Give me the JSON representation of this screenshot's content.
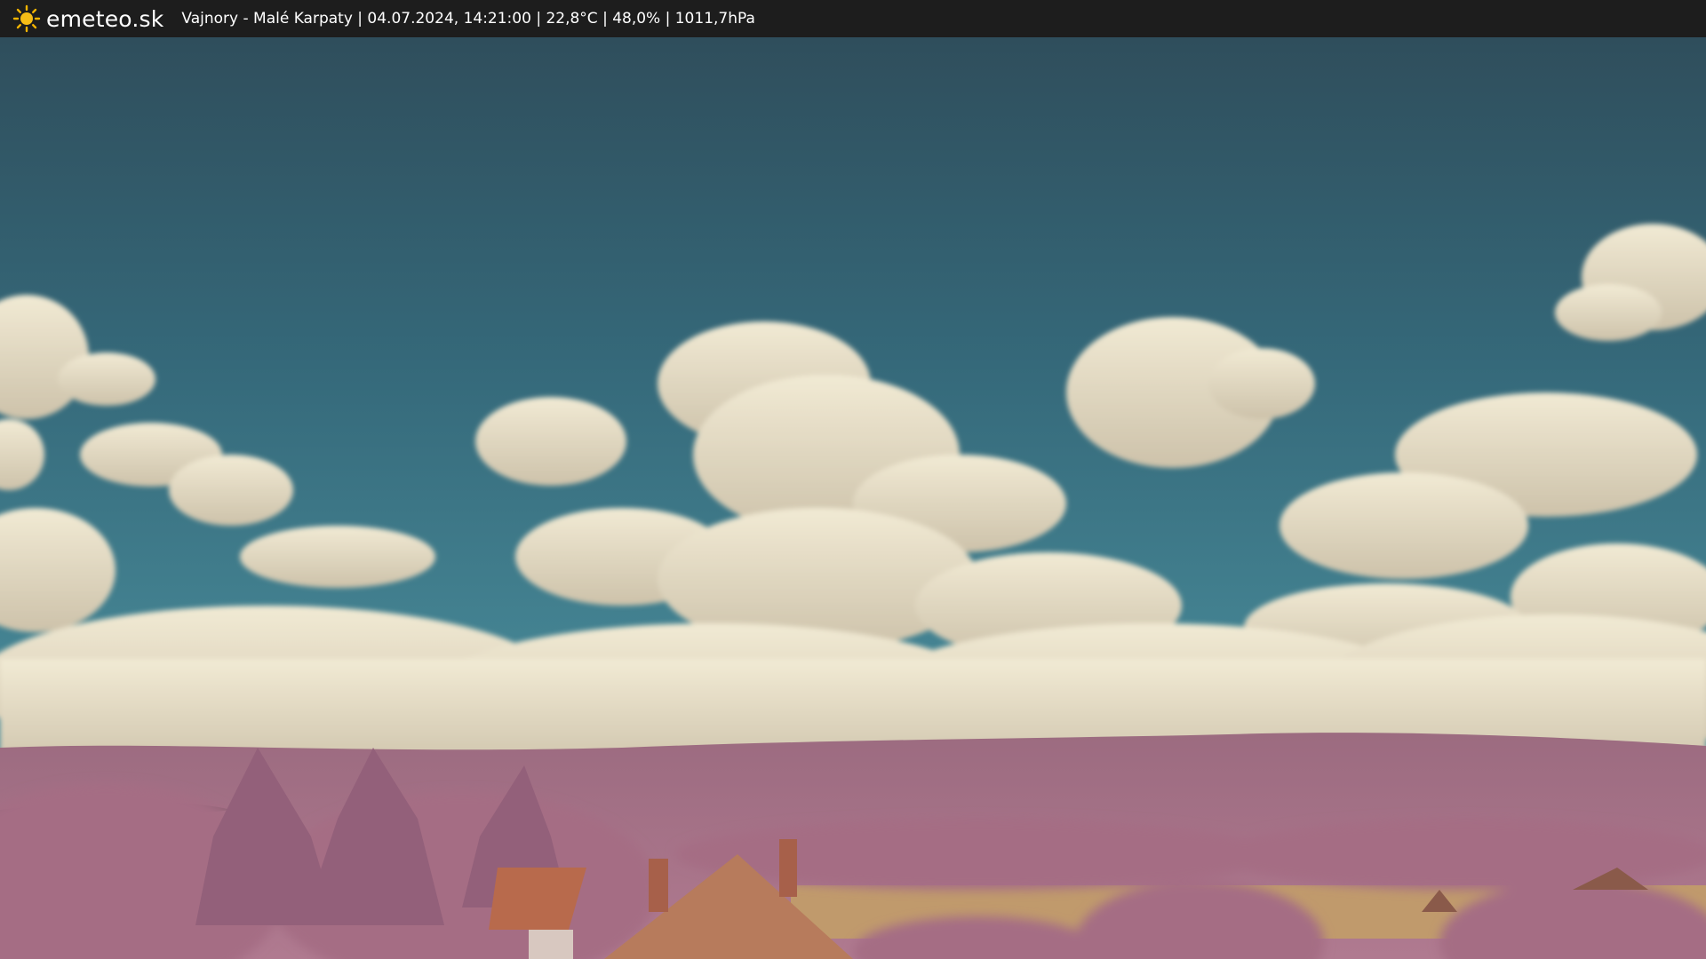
{
  "header": {
    "brand": "emeteo.sk",
    "caption": "Vajnory - Malé Karpaty | 04.07.2024, 14:21:00 | 22,8°C | 48,0% | 1011,7hPa",
    "logo_icon": "sun-icon",
    "brand_color": "#f4b400"
  },
  "scene": {
    "description_icon": "webcam-image",
    "colors": {
      "sky_top": "#2f4e5c",
      "sky_bottom": "#3f8596",
      "cloud": "#ece3cb",
      "vegetation": "#a86f86",
      "field": "#c09a6c",
      "roof": "#b86a4c"
    }
  }
}
